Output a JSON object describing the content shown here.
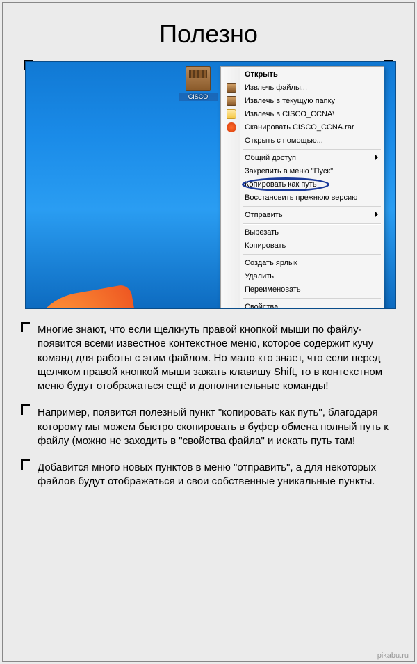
{
  "title": "Полезно",
  "file": {
    "label": "CISCO"
  },
  "menu": {
    "open": "Открыть",
    "extract_files": "Извлечь файлы...",
    "extract_here": "Извлечь в текущую папку",
    "extract_to": "Извлечь в CISCO_CCNA\\",
    "scan": "Сканировать CISCO_CCNA.rar",
    "open_with": "Открыть с помощью...",
    "share": "Общий доступ",
    "pin_start": "Закрепить в меню \"Пуск\"",
    "copy_path": "Копировать как путь",
    "restore_prev": "Восстановить прежнюю версию",
    "send_to": "Отправить",
    "cut": "Вырезать",
    "copy": "Копировать",
    "shortcut": "Создать ярлык",
    "delete": "Удалить",
    "rename": "Переименовать",
    "properties": "Свойства"
  },
  "para1": "Многие знают, что если щелкнуть правой кнопкой мыши по файлу-появится всеми известное контекстное меню, которое содержит кучу команд для работы с этим файлом. Но мало кто знает, что если перед щелчком правой кнопкой мыши зажать клавишу Shift, то в контекстном меню будут отображаться ещё и дополнительные команды!",
  "para2": "Например, появится полезный пункт \"копировать как путь\", благодаря которому мы можем быстро скопировать в буфер обмена полный путь к файлу (можно не заходить в \"свойства файла\" и искать путь там!",
  "para3": "Добавится много новых пунктов в меню \"отправить\", а для некоторых файлов будут отображаться и свои собственные уникальные пункты.",
  "watermark": "pikabu.ru"
}
